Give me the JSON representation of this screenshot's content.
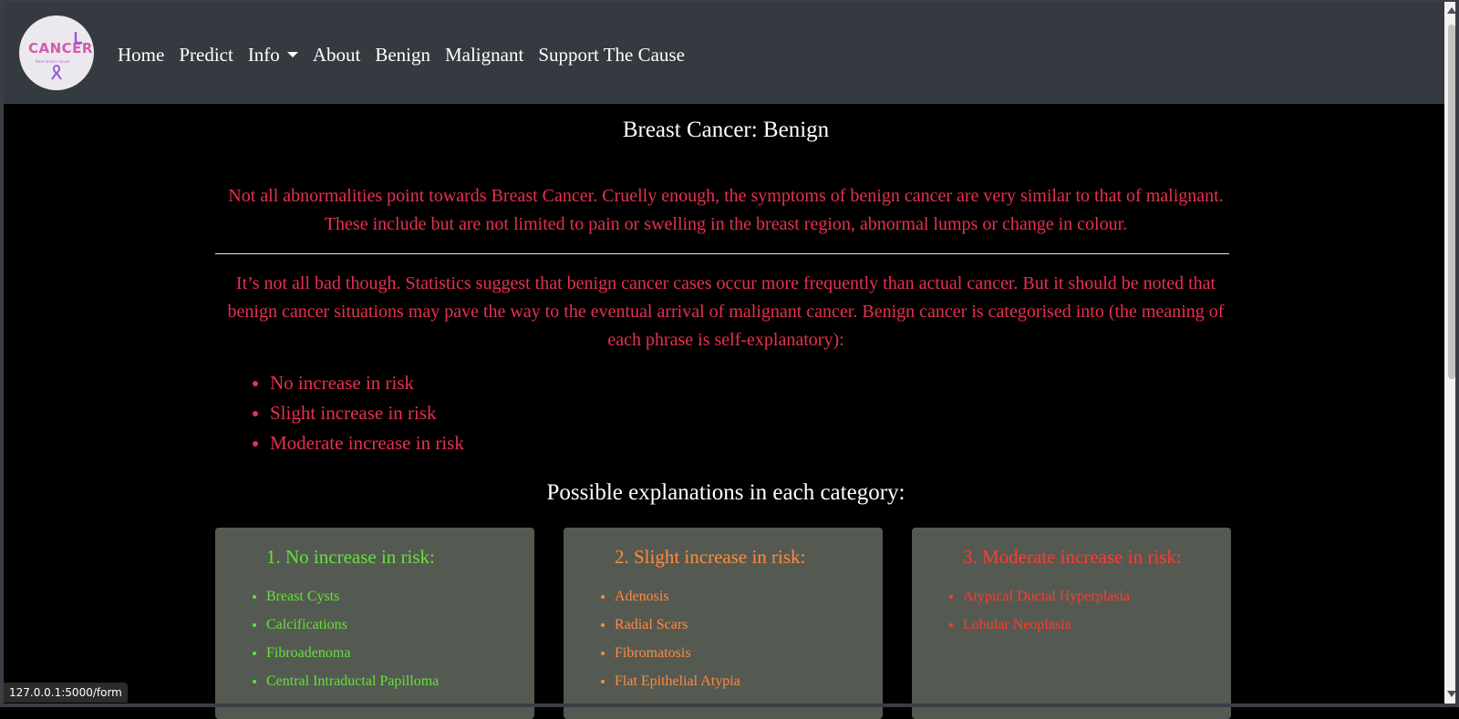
{
  "nav": {
    "logo_text": "CANCER",
    "logo_subtext": "Beat breast cancer",
    "links": [
      "Home",
      "Predict",
      "Info",
      "About",
      "Benign",
      "Malignant",
      "Support The Cause"
    ]
  },
  "page": {
    "title": "Breast Cancer: Benign",
    "para1": "Not all abnormalities point towards Breast Cancer. Cruelly enough, the symptoms of benign cancer are very similar to that of malignant. These include but are not limited to pain or swelling in the breast region, abnormal lumps or change in colour.",
    "para2": "It’s not all bad though. Statistics suggest that benign cancer cases occur more frequently than actual cancer. But it should be noted that benign cancer situations may pave the way to the eventual arrival of malignant cancer. Benign cancer is categorised into (the meaning of each phrase is self-explanatory):",
    "risk_levels": [
      "No increase in risk",
      "Slight increase in risk",
      "Moderate increase in risk"
    ],
    "subtitle": "Possible explanations in each category:"
  },
  "cards": [
    {
      "title": "1. No increase in risk:",
      "color": "#66e03a",
      "items": [
        "Breast Cysts",
        "Calcifications",
        "Fibroadenoma",
        "Central Intraductal Papilloma"
      ]
    },
    {
      "title": "2. Slight increase in risk:",
      "color": "#ff8a3d",
      "items": [
        "Adenosis",
        "Radial Scars",
        "Fibromatosis",
        "Flat Epithelial Atypia"
      ]
    },
    {
      "title": "3. Moderate increase in risk:",
      "color": "#ff3b2f",
      "items": [
        "Atypical Ductal Hyperplasia",
        "Lobular Neoplasia"
      ]
    }
  ],
  "status": {
    "url": "127.0.0.1:5000/form"
  },
  "colors": {
    "navbar": "#343a40",
    "text_accent": "#e8304f",
    "card_bg": "#545a52"
  }
}
